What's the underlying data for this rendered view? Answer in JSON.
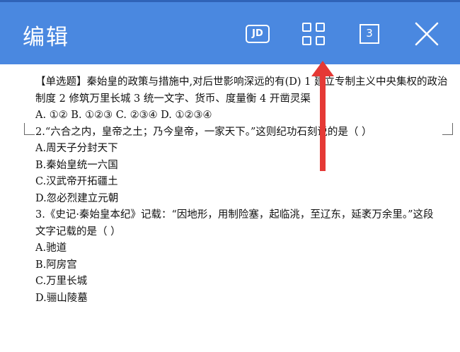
{
  "header": {
    "title": "编辑",
    "jd_label": "JD",
    "page_count": "3"
  },
  "document": {
    "lines": [
      "【单选题】秦始皇的政策与措施中,对后世影响深远的有(D) 1 建立专制主义中央集权的政治",
      "制度 2 修筑万里长城 3 统一文字、货币、度量衡 4 开凿灵渠",
      "A. ①② B. ①②③ C. ②③④ D. ①②③④",
      "2.“六合之内，皇帝之土；乃今皇帝，一家天下。”这则纪功石刻说的是（     ）",
      "A.周天子分封天下",
      "B.秦始皇统一六国",
      "C.汉武帝开拓疆土",
      "D.忽必烈建立元朝",
      "3.《史记·秦始皇本纪》记载：“因地形，用制险塞，起临洮，至辽东，延袤万余里。”这段",
      "文字记载的是（     ）",
      "A.驰道",
      "B.阿房宫",
      "C.万里长城",
      "D.骊山陵墓"
    ]
  },
  "colors": {
    "header_bg": "#4a88e0",
    "arrow": "#e53935"
  },
  "icons": [
    "jd-icon",
    "grid-icon",
    "page-count-icon",
    "close-icon"
  ]
}
